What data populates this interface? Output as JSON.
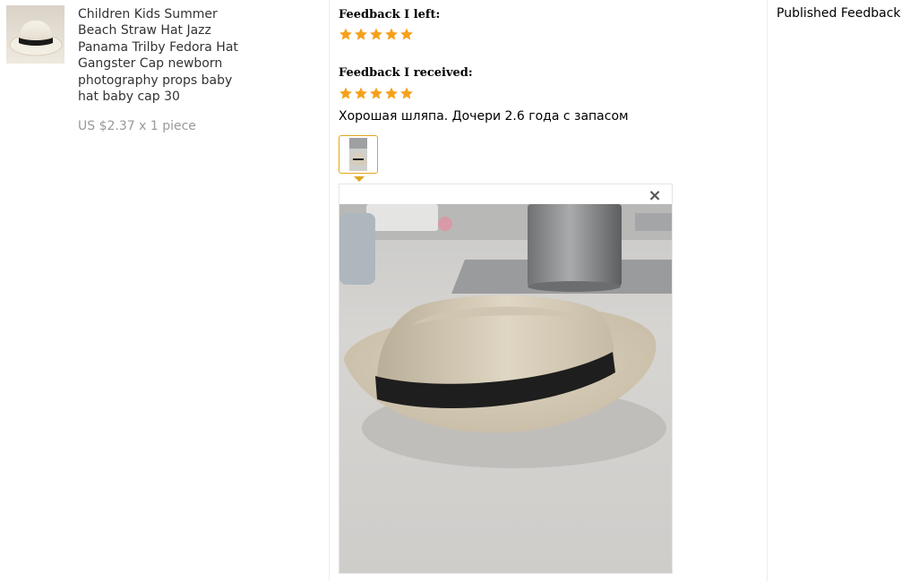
{
  "product": {
    "image_alt": "straw fedora hat with black band",
    "title": "Children Kids Summer Beach Straw Hat Jazz Panama Trilby Fedora Hat Gangster Cap newborn photography props baby hat baby cap 30",
    "price": "US $2.37 x 1 piece"
  },
  "feedback": {
    "left_heading": "Feedback I left:",
    "left_rating": 5,
    "received_heading": "Feedback I received:",
    "received_rating": 5,
    "review_text": "Хорошая шляпа. Дочери 2.6 года с запасом",
    "star_color": "#f6a01b",
    "highlight_color": "#e0a61c"
  },
  "viewer": {
    "close_label": "×",
    "photo_alt": "buyer photo of straw fedora hat on a desk"
  },
  "status": {
    "label": "Published Feedback"
  },
  "icons": {
    "star": "star-icon",
    "close": "close-icon"
  }
}
